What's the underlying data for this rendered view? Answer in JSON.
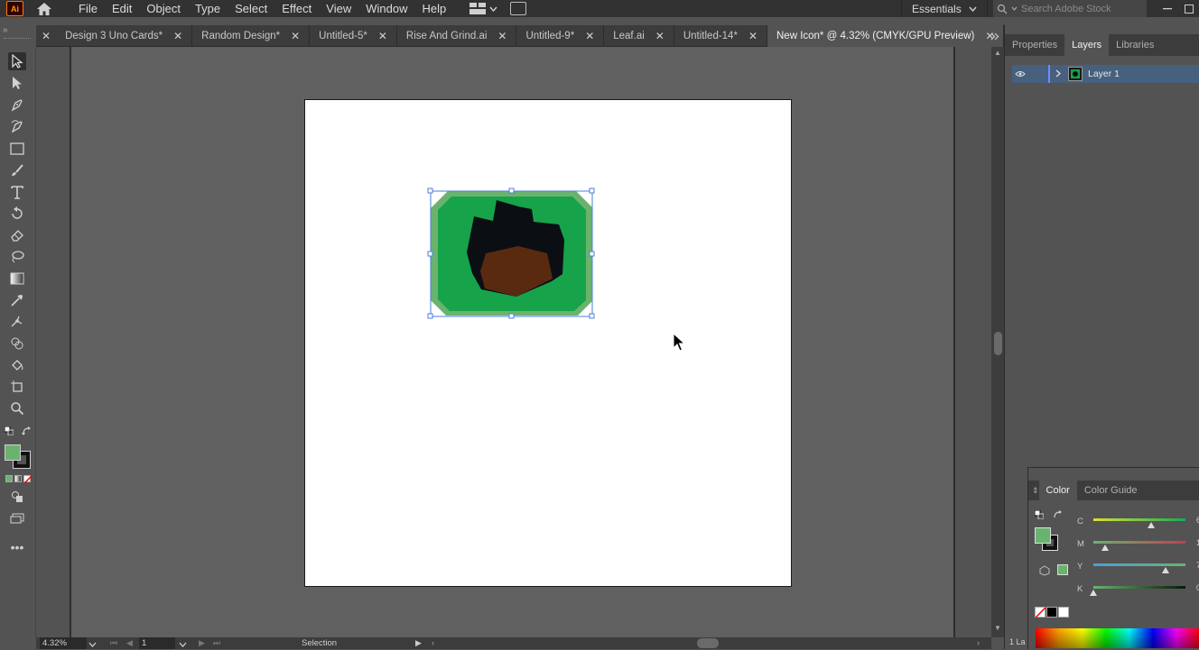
{
  "app": {
    "logo_text": "Ai"
  },
  "menu": [
    "File",
    "Edit",
    "Object",
    "Type",
    "Select",
    "Effect",
    "View",
    "Window",
    "Help"
  ],
  "workspace": {
    "label": "Essentials"
  },
  "search": {
    "placeholder": "Search Adobe Stock"
  },
  "tabs": [
    {
      "label": "Design 3 Uno Cards*"
    },
    {
      "label": "Random Design*"
    },
    {
      "label": "Untitled-5*"
    },
    {
      "label": "Rise And Grind.ai"
    },
    {
      "label": "Untitled-9*"
    },
    {
      "label": "Leaf.ai"
    },
    {
      "label": "Untitled-14*"
    },
    {
      "label": "New Icon* @ 4.32% (CMYK/GPU Preview)"
    }
  ],
  "panels": {
    "tabs": [
      "Properties",
      "Layers",
      "Libraries"
    ],
    "active": "Layers",
    "layers": [
      {
        "name": "Layer 1"
      }
    ]
  },
  "color_panel": {
    "tabs": [
      "Color",
      "Color Guide"
    ],
    "sliders": [
      {
        "label": "C",
        "value": "6",
        "position": 0.63
      },
      {
        "label": "M",
        "value": "1",
        "position": 0.13
      },
      {
        "label": "Y",
        "value": "7",
        "position": 0.79
      },
      {
        "label": "K",
        "value": "0",
        "position": 0.0
      }
    ],
    "fill_color": "#6ab36e"
  },
  "status": {
    "zoom": "4.32%",
    "page": "1",
    "tool_name": "Selection",
    "layers_count": "1 La"
  },
  "colors": {
    "icon_outer": "#6ab36e",
    "icon_inner": "#16a34a",
    "hair": "#0b0f14",
    "face": "#5a2a10",
    "selection": "#4a7fd8"
  }
}
